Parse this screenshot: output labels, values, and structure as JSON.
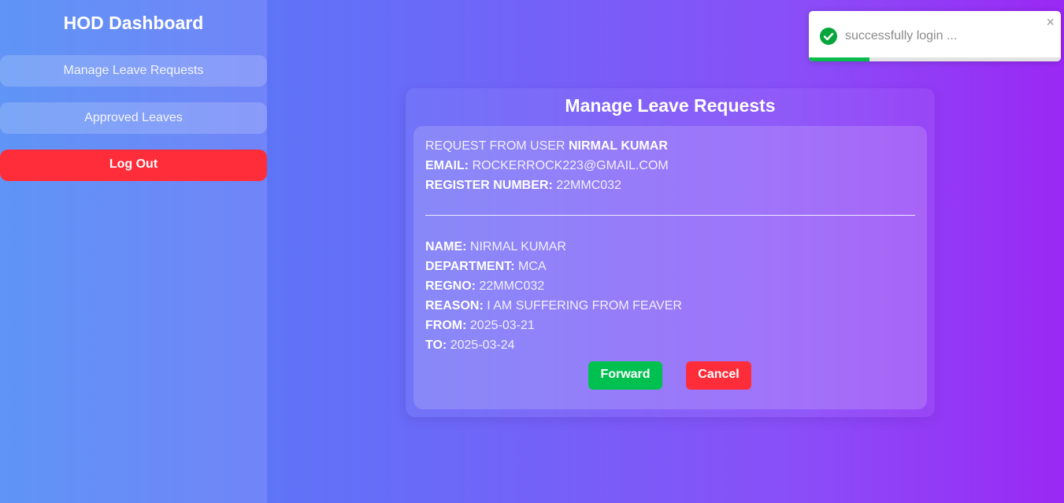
{
  "sidebar": {
    "title": "HOD Dashboard",
    "items": [
      {
        "label": "Manage Leave Requests"
      },
      {
        "label": "Approved Leaves"
      }
    ],
    "logout_label": "Log Out"
  },
  "main": {
    "title": "Manage Leave Requests",
    "request": {
      "header_prefix": "REQUEST FROM USER",
      "header_user": "NIRMAL KUMAR",
      "email_label": "EMAIL:",
      "email_value": "ROCKERROCK223@GMAIL.COM",
      "register_label": "REGISTER NUMBER:",
      "register_value": "22MMC032",
      "details": [
        {
          "label": "NAME:",
          "value": "NIRMAL KUMAR"
        },
        {
          "label": "DEPARTMENT:",
          "value": "MCA"
        },
        {
          "label": "REGNO:",
          "value": "22MMC032"
        },
        {
          "label": "REASON:",
          "value": "I AM SUFFERING FROM FEAVER"
        },
        {
          "label": "FROM:",
          "value": "2025-03-21"
        },
        {
          "label": "TO:",
          "value": "2025-03-24"
        }
      ],
      "forward_label": "Forward",
      "cancel_label": "Cancel"
    }
  },
  "toast": {
    "message": "successfully login ...",
    "close_glyph": "×",
    "icon": "check-circle-icon",
    "progress": 0.24,
    "colors": {
      "success": "#07bc4c",
      "cancel": "#ff2d3a",
      "forward": "#00c050"
    }
  }
}
